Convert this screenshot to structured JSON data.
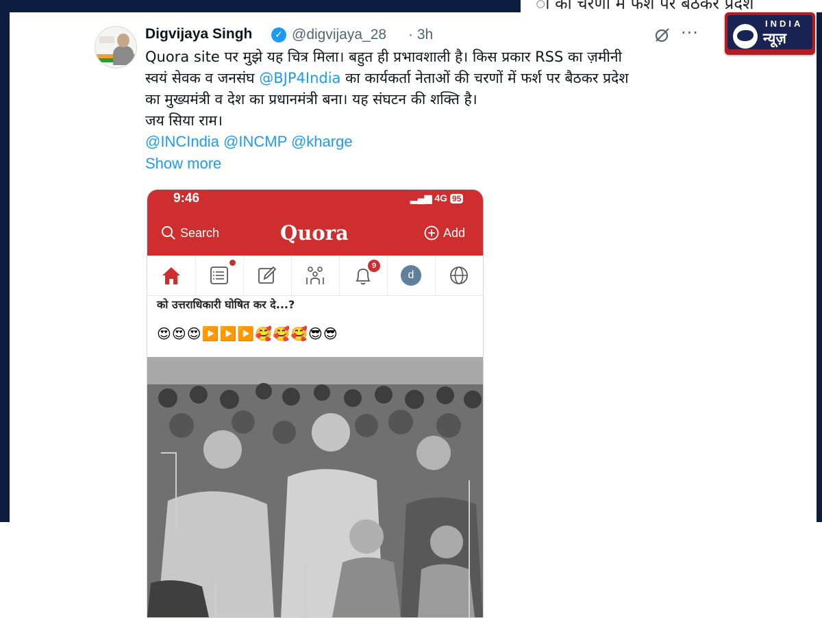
{
  "top_bleed_text": "ो की चरणों में फर्श पर बैठकर प्रदेश",
  "badge": {
    "line1": "INDIA",
    "line2": "न्यूज़"
  },
  "tweet": {
    "display_name": "Digvijaya Singh",
    "handle": "@digvijaya_28",
    "time": "· 3h",
    "more_label": "···",
    "body": {
      "line1": "Quora site पर मुझे यह चित्र मिला। बहुत ही प्रभावशाली है। किस प्रकार RSS का ज़मीनी",
      "line2_a": "स्वयं सेवक व जनसंघ ",
      "line2_mention": "@BJP4India",
      "line2_b": " का कार्यकर्ता नेताओं की चरणों में फर्श पर बैठकर प्रदेश",
      "line3": "का मुख्यमंत्री व देश का प्रधानमंत्री बना। यह संघटन की शक्ति है।",
      "line4": "जय सिया राम।"
    },
    "tags": "@INCIndia @INCMP @kharge",
    "show_more": "Show more"
  },
  "quora": {
    "time": "9:46",
    "network": "4G",
    "battery": "95",
    "search_label": "Search",
    "logo": "Quora",
    "add_label": "Add",
    "nav_icons": [
      "home-icon",
      "feed-icon",
      "write-icon",
      "spaces-icon",
      "bell-icon",
      "profile-avatar",
      "globe-icon"
    ],
    "bell_count": "9",
    "avatar_letter": "d",
    "question": "को उत्तराधिकारी घोषित कर दे...?",
    "emoji_row": "😍😍😍▶️▶️▶️🥰🥰🥰😎😎"
  },
  "colors": {
    "navy": "#0c1d40",
    "quora_red": "#cf2e2e",
    "link_blue": "#1d9bf0",
    "badge_red": "#b01d22"
  }
}
